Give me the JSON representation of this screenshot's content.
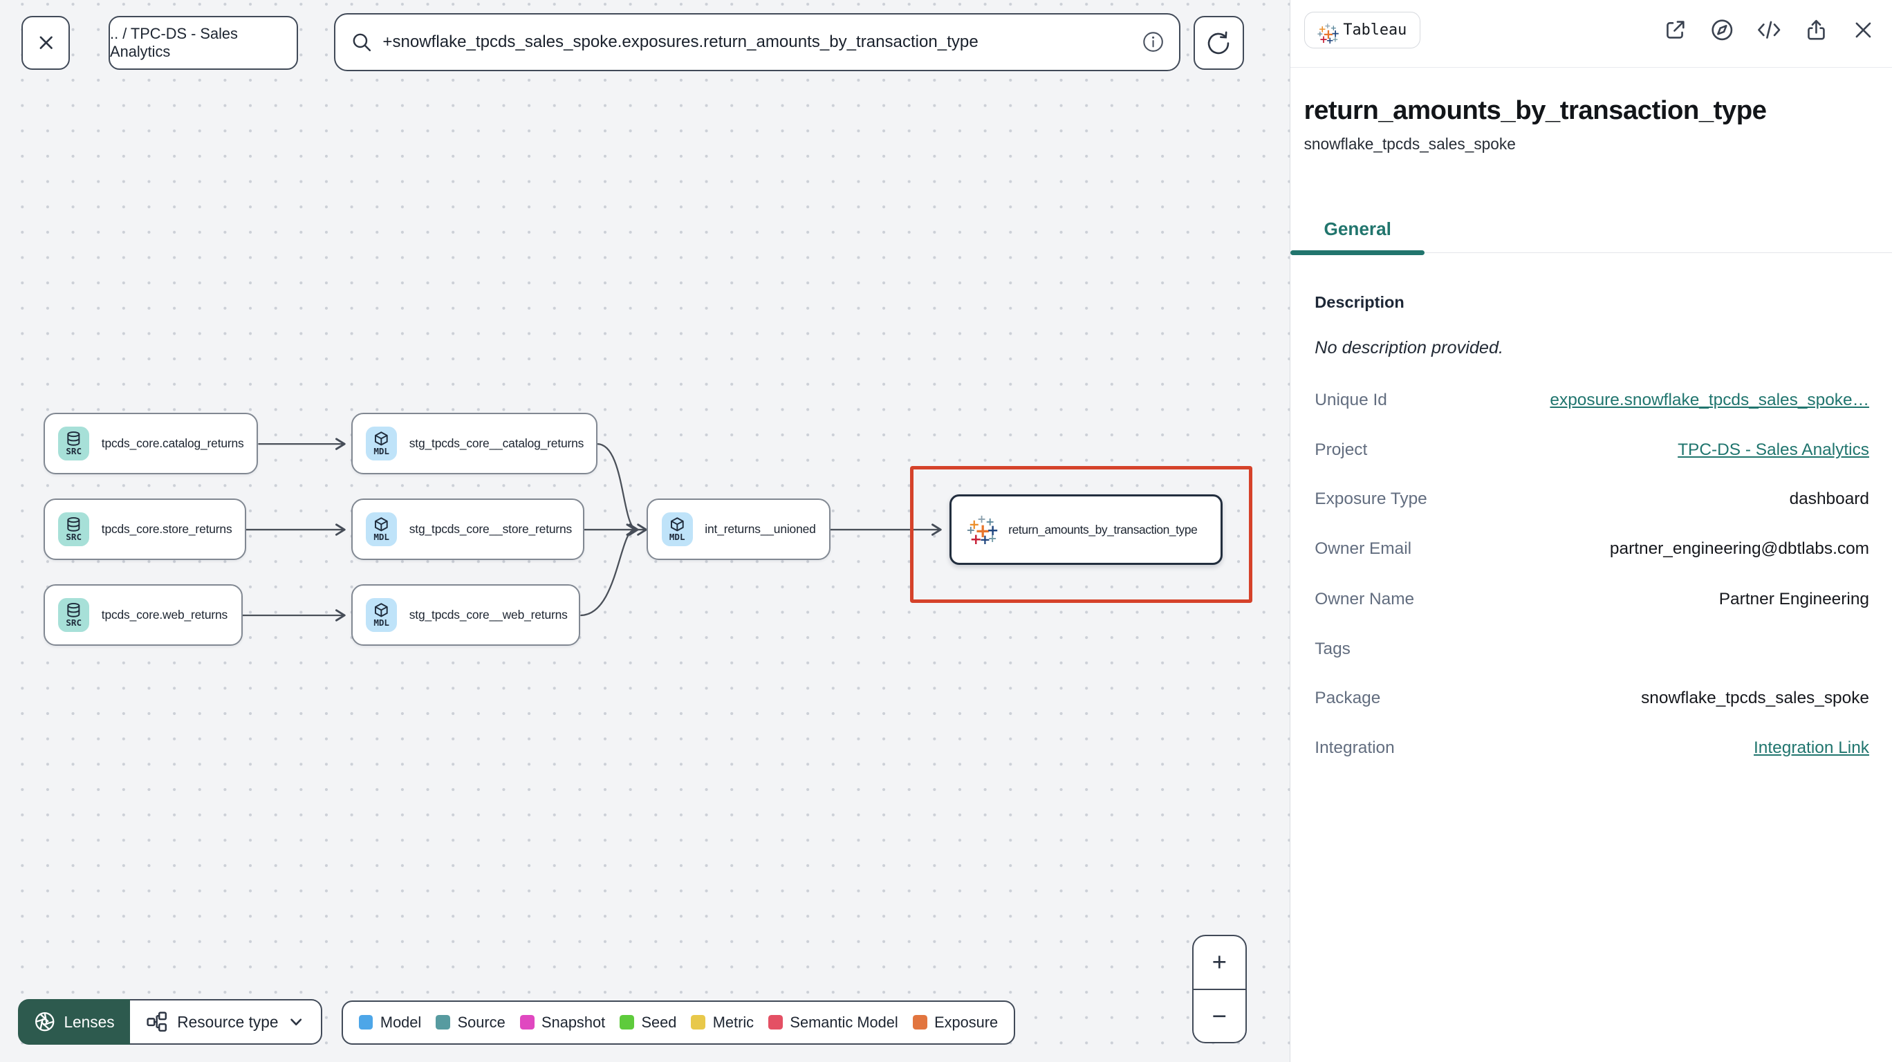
{
  "topbar": {
    "breadcrumb": ".. / TPC-DS - Sales Analytics",
    "search_value": "+snowflake_tpcds_sales_spoke.exposures.return_amounts_by_transaction_type"
  },
  "graph": {
    "nodes": [
      {
        "badge": "SRC",
        "label": "tpcds_core.catalog_returns"
      },
      {
        "badge": "SRC",
        "label": "tpcds_core.store_returns"
      },
      {
        "badge": "SRC",
        "label": "tpcds_core.web_returns"
      },
      {
        "badge": "MDL",
        "label": "stg_tpcds_core__catalog_returns"
      },
      {
        "badge": "MDL",
        "label": "stg_tpcds_core__store_returns"
      },
      {
        "badge": "MDL",
        "label": "stg_tpcds_core__web_returns"
      },
      {
        "badge": "MDL",
        "label": "int_returns__unioned"
      },
      {
        "badge": "tableau",
        "label": "return_amounts_by_transaction_type"
      }
    ],
    "zoom_in": "+",
    "zoom_out": "−"
  },
  "toolbar": {
    "lenses_label": "Lenses",
    "resource_type_label": "Resource type"
  },
  "legend": {
    "items": [
      {
        "label": "Model",
        "color": "#4da6e8"
      },
      {
        "label": "Source",
        "color": "#579ba0"
      },
      {
        "label": "Snapshot",
        "color": "#e048c0"
      },
      {
        "label": "Seed",
        "color": "#5ecb3c"
      },
      {
        "label": "Metric",
        "color": "#e8c84a"
      },
      {
        "label": "Semantic Model",
        "color": "#e45064"
      },
      {
        "label": "Exposure",
        "color": "#e2753f"
      }
    ]
  },
  "panel": {
    "integration_badge": "Tableau",
    "title": "return_amounts_by_transaction_type",
    "subtitle": "snowflake_tpcds_sales_spoke",
    "tab_general": "General",
    "description_heading": "Description",
    "description_empty": "No description provided.",
    "fields": [
      {
        "label": "Unique Id",
        "value": "exposure.snowflake_tpcds_sales_spoke…"
      },
      {
        "label": "Project",
        "value": "TPC-DS - Sales Analytics"
      },
      {
        "label": "Exposure Type",
        "value": "dashboard"
      },
      {
        "label": "Owner Email",
        "value": "partner_engineering@dbtlabs.com"
      },
      {
        "label": "Owner Name",
        "value": "Partner Engineering"
      },
      {
        "label": "Tags",
        "value": ""
      },
      {
        "label": "Package",
        "value": "snowflake_tpcds_sales_spoke"
      },
      {
        "label": "Integration",
        "value": "Integration Link"
      }
    ]
  },
  "colors": {
    "accent_teal": "#21756d",
    "selection_red": "#d5422a",
    "lenses_green": "#2d5a4e",
    "src_badge": "#a7e0d8",
    "mdl_badge": "#bfe3f9"
  }
}
